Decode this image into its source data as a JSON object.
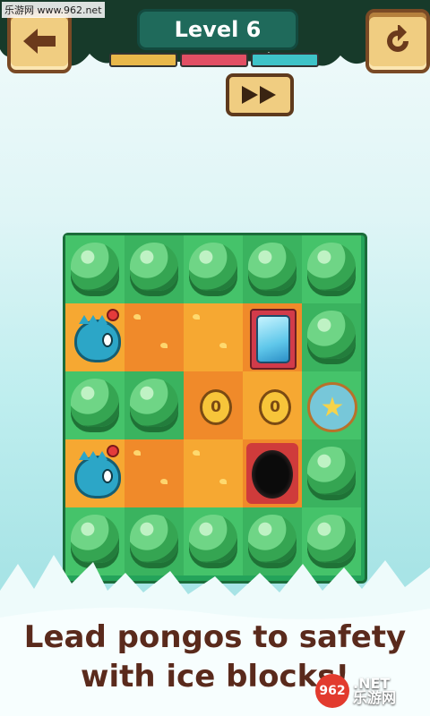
{
  "watermark_top": "乐游网 www.962.net",
  "header": {
    "level_label": "Level 6",
    "back_icon": "arrow-left-icon",
    "restart_icon": "restart-icon",
    "fastforward_icon": "fast-forward-icon"
  },
  "progress_bars": [
    {
      "color": "#e9b84a"
    },
    {
      "color": "#e24f64"
    },
    {
      "color": "#3ec3c8"
    }
  ],
  "board": {
    "rows": [
      [
        "bush",
        "bush",
        "bush",
        "bush",
        "bush"
      ],
      [
        "pongo",
        "tile",
        "tile",
        "ice",
        "bush"
      ],
      [
        "bush",
        "bush",
        "coin",
        "coin",
        "goal"
      ],
      [
        "pongo",
        "tile",
        "tile",
        "hole",
        "bush"
      ],
      [
        "bush",
        "bush",
        "bush",
        "bush",
        "bush"
      ]
    ],
    "coin_value": "0"
  },
  "caption": {
    "line1": "Lead pongos to safety",
    "line2": "with ice blocks!"
  },
  "watermark_bottom": {
    "logo": "962",
    "text1": ".NET",
    "text2": "乐游网"
  },
  "colors": {
    "board_green": "#3ab35f",
    "tile_orange": "#f08a2a",
    "caption_brown": "#5a2a1c"
  }
}
